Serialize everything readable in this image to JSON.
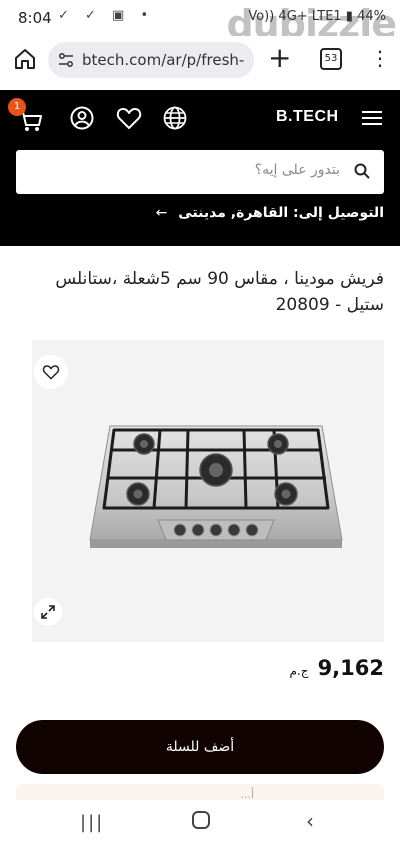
{
  "status_bar": {
    "time": "8:04",
    "icons": "✓ ✓ ▣ •",
    "right_text": "Vo)) 4G+ LTE1 ▮ 44%",
    "watermark": "dubizzle"
  },
  "browser": {
    "url": "btech.com/ar/p/fresh-",
    "tabs_count": "53"
  },
  "site_header": {
    "cart_badge": "1",
    "logo": "B.TECH",
    "search_placeholder": "بتدور على إيه؟",
    "delivery_text": "التوصيل إلى: القاهرة, مدينتى",
    "delivery_arrow": "←"
  },
  "product": {
    "title": "فريش مودينا ، مقاس 90 سم 5شعلة ،ستانلس ستيل - 20809",
    "price": "9,162",
    "currency": "ج.م",
    "add_to_cart": "أضف للسلة",
    "peek_text": "...أ"
  },
  "colors": {
    "header_bg": "#000000",
    "badge": "#e8541a",
    "cta_bg": "#120303"
  }
}
